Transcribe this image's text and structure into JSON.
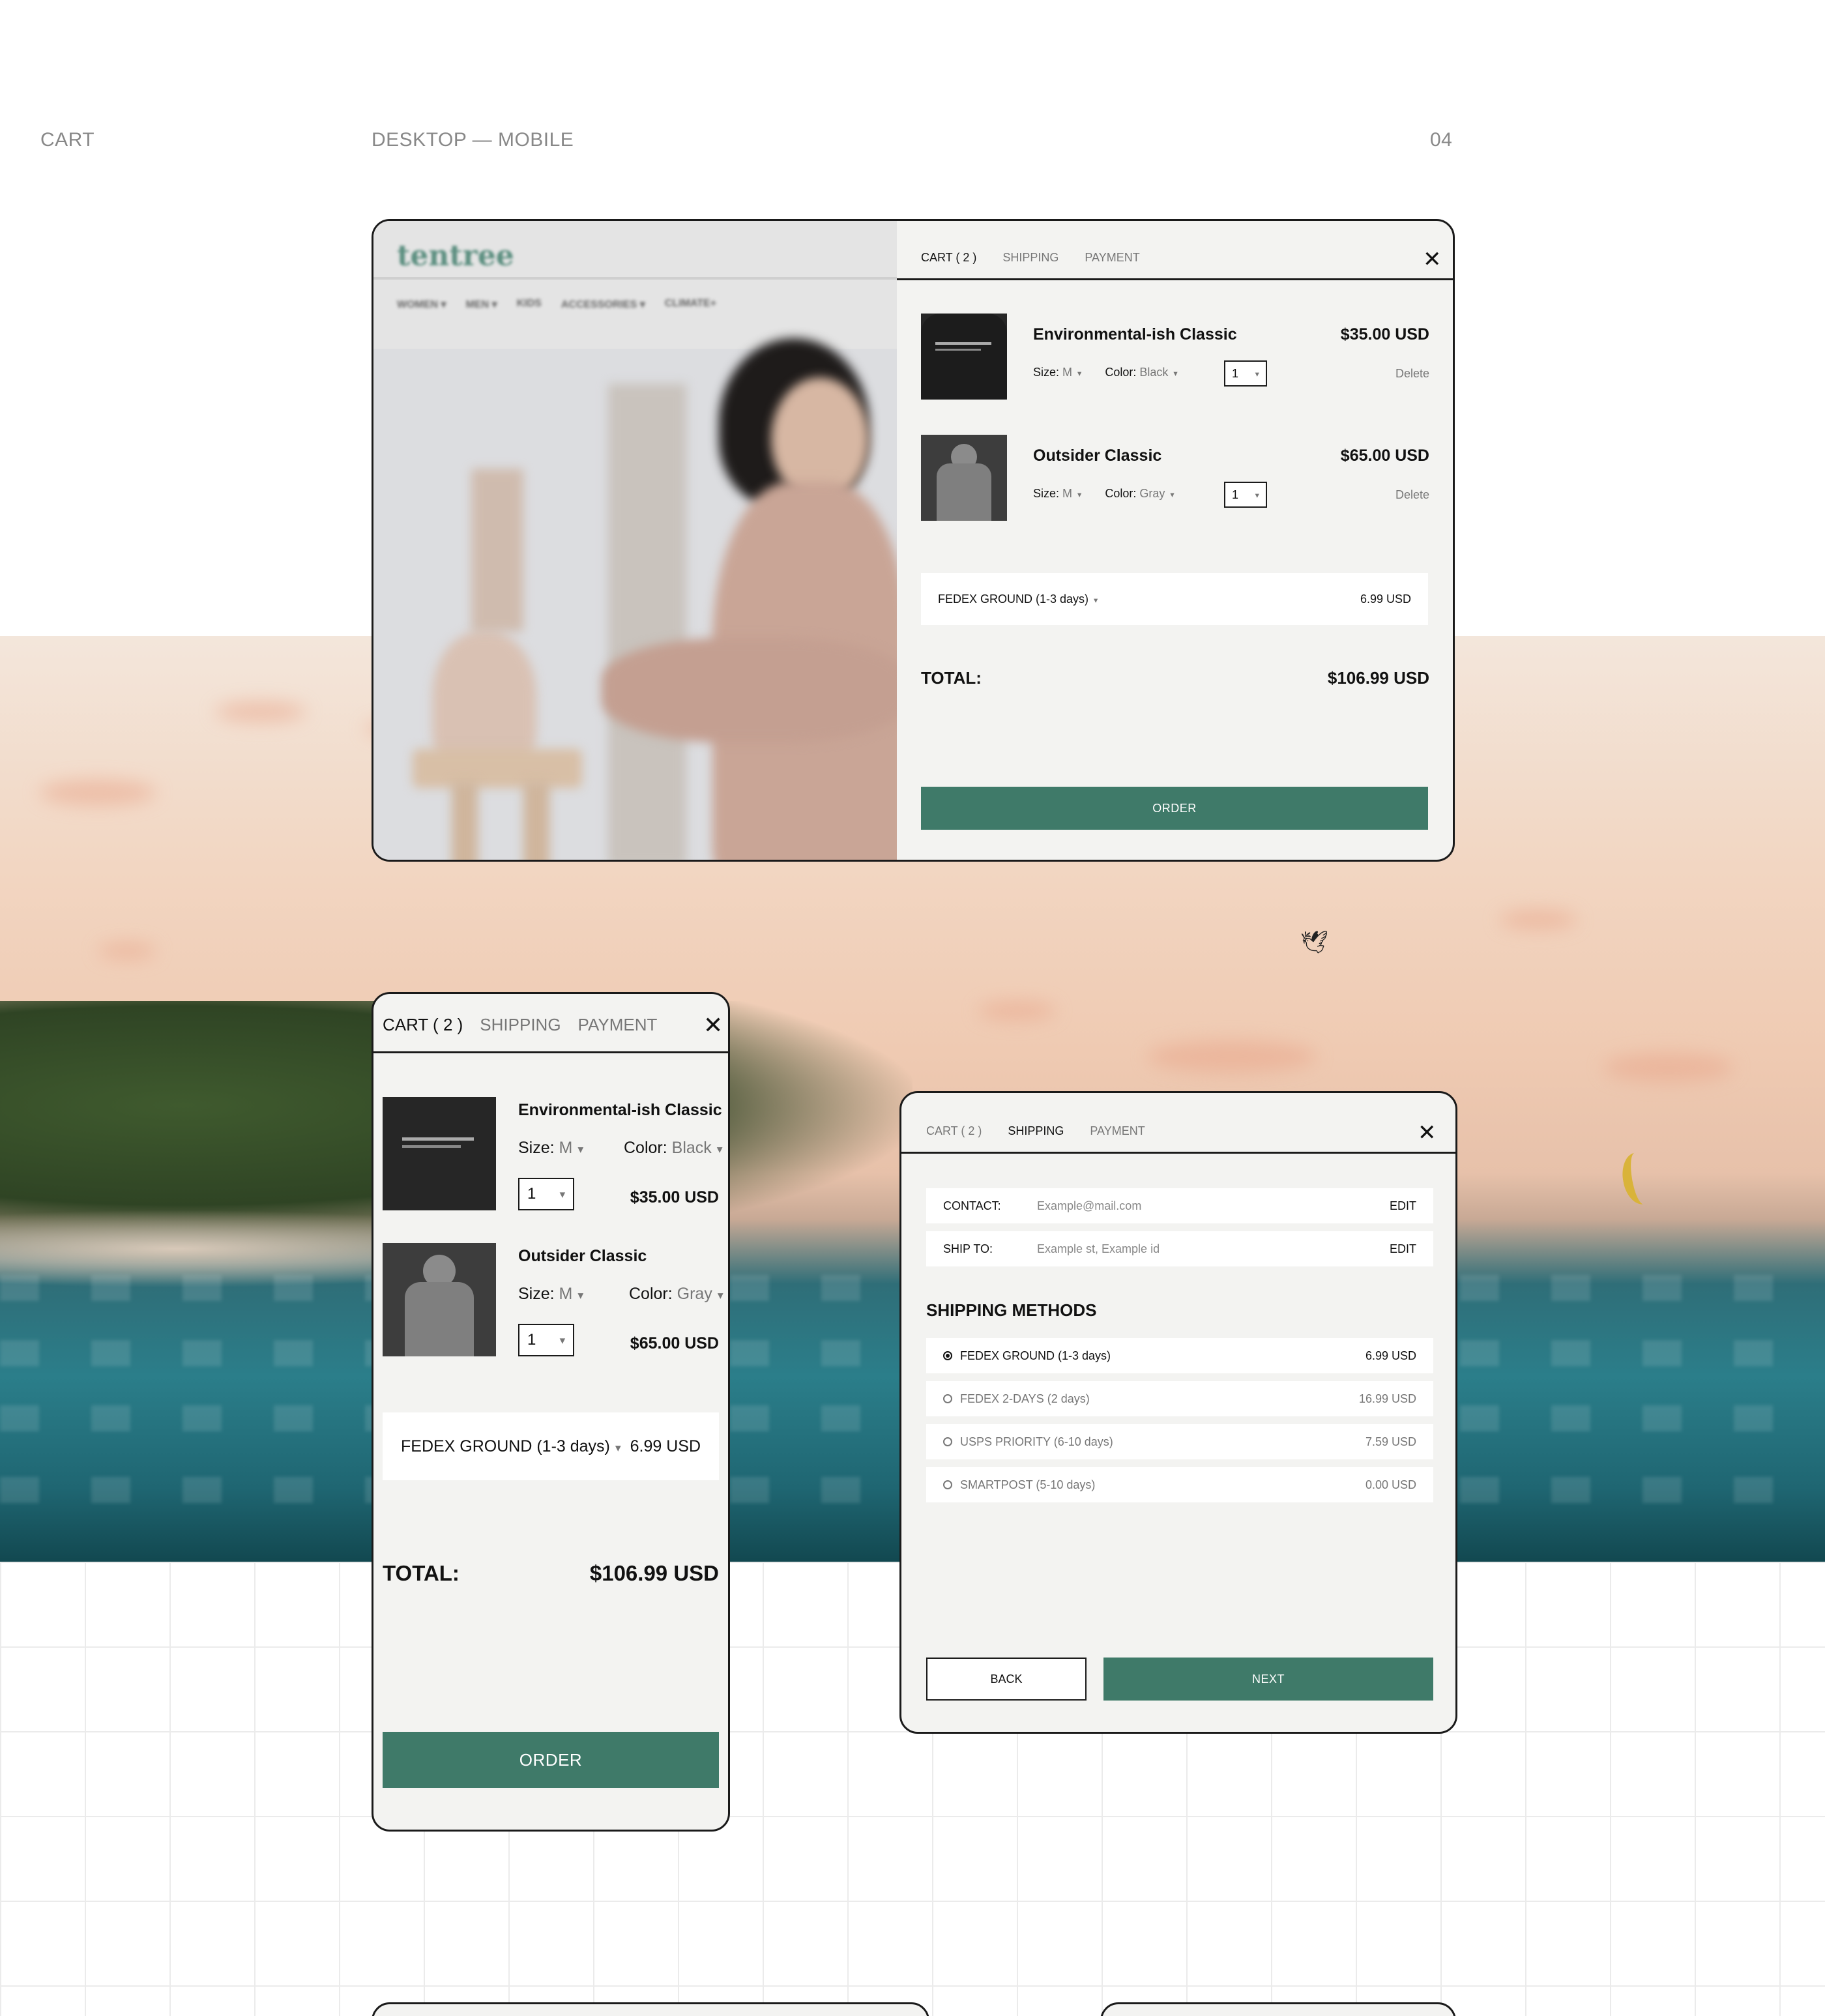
{
  "header": {
    "left": "CART",
    "center": "DESKTOP — MOBILE",
    "right": "04"
  },
  "desktop_cart": {
    "brand": "tentree",
    "nav": [
      "WOMEN ▾",
      "MEN ▾",
      "KIDS",
      "ACCESSORIES ▾",
      "CLIMATE+"
    ],
    "tabs": [
      "CART ( 2 )",
      "SHIPPING",
      "PAYMENT"
    ],
    "items": [
      {
        "name": "Environmental-ish Classic",
        "price": "$35.00 USD",
        "size_label": "Size:",
        "size": "M",
        "color_label": "Color:",
        "color": "Black",
        "qty": "1",
        "delete": "Delete"
      },
      {
        "name": "Outsider Classic",
        "price": "$65.00 USD",
        "size_label": "Size:",
        "size": "M",
        "color_label": "Color:",
        "color": "Gray",
        "qty": "1",
        "delete": "Delete"
      }
    ],
    "shipping": {
      "method": "FEDEX GROUND (1-3 days)",
      "price": "6.99 USD"
    },
    "total_label": "TOTAL:",
    "total": "$106.99 USD",
    "order": "ORDER"
  },
  "mobile_cart": {
    "tabs": [
      "CART ( 2 )",
      "SHIPPING",
      "PAYMENT"
    ],
    "items": [
      {
        "name": "Environmental-ish Classic",
        "size_label": "Size:",
        "size": "M",
        "color_label": "Color:",
        "color": "Black",
        "qty": "1",
        "price": "$35.00 USD"
      },
      {
        "name": "Outsider Classic",
        "size_label": "Size:",
        "size": "M",
        "color_label": "Color:",
        "color": "Gray",
        "qty": "1",
        "price": "$65.00 USD"
      }
    ],
    "shipping": {
      "method": "FEDEX GROUND (1-3 days)",
      "price": "6.99 USD"
    },
    "total_label": "TOTAL:",
    "total": "$106.99 USD",
    "order": "ORDER"
  },
  "shipping_panel": {
    "tabs": [
      "CART ( 2 )",
      "SHIPPING",
      "PAYMENT"
    ],
    "contact": {
      "label": "CONTACT:",
      "placeholder": "Example@mail.com",
      "edit": "EDIT"
    },
    "ship_to": {
      "label": "SHIP TO:",
      "placeholder": "Example st, Example id",
      "edit": "EDIT"
    },
    "methods_title": "SHIPPING METHODS",
    "methods": [
      {
        "name": "FEDEX GROUND (1-3 days)",
        "price": "6.99 USD",
        "selected": true
      },
      {
        "name": "FEDEX 2-DAYS (2 days)",
        "price": "16.99 USD",
        "selected": false
      },
      {
        "name": "USPS PRIORITY (6-10 days)",
        "price": "7.59 USD",
        "selected": false
      },
      {
        "name": "SMARTPOST (5-10 days)",
        "price": "0.00 USD",
        "selected": false
      }
    ],
    "back": "BACK",
    "next": "NEXT"
  },
  "colors": {
    "accent": "#3f7a69",
    "frame": "#f3f3f1",
    "border": "#1a1a1a"
  }
}
